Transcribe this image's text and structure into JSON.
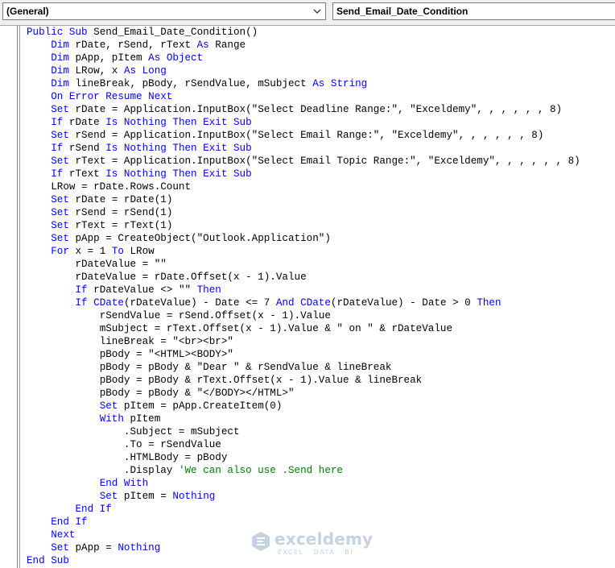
{
  "header": {
    "object_combo": "(General)",
    "procedure_combo": "Send_Email_Date_Condition"
  },
  "colors": {
    "keyword": "#0000ff",
    "comment": "#008000",
    "text": "#000000"
  },
  "code": [
    {
      "indent": 0,
      "parts": [
        [
          "kw",
          "Public Sub"
        ],
        [
          "t",
          " Send_Email_Date_Condition()"
        ]
      ]
    },
    {
      "indent": 1,
      "parts": [
        [
          "kw",
          "Dim"
        ],
        [
          "t",
          " rDate, rSend, rText "
        ],
        [
          "kw",
          "As"
        ],
        [
          "t",
          " Range"
        ]
      ]
    },
    {
      "indent": 1,
      "parts": [
        [
          "kw",
          "Dim"
        ],
        [
          "t",
          " pApp, pItem "
        ],
        [
          "kw",
          "As Object"
        ]
      ]
    },
    {
      "indent": 1,
      "parts": [
        [
          "kw",
          "Dim"
        ],
        [
          "t",
          " LRow, x "
        ],
        [
          "kw",
          "As Long"
        ]
      ]
    },
    {
      "indent": 1,
      "parts": [
        [
          "kw",
          "Dim"
        ],
        [
          "t",
          " lineBreak, pBody, rSendValue, mSubject "
        ],
        [
          "kw",
          "As String"
        ]
      ]
    },
    {
      "indent": 1,
      "parts": [
        [
          "kw",
          "On Error Resume Next"
        ]
      ]
    },
    {
      "indent": 1,
      "parts": [
        [
          "kw",
          "Set"
        ],
        [
          "t",
          " rDate = Application.InputBox(\"Select Deadline Range:\", \"Exceldemy\", , , , , , 8)"
        ]
      ]
    },
    {
      "indent": 1,
      "parts": [
        [
          "kw",
          "If"
        ],
        [
          "t",
          " rDate "
        ],
        [
          "kw",
          "Is Nothing Then Exit Sub"
        ]
      ]
    },
    {
      "indent": 1,
      "parts": [
        [
          "kw",
          "Set"
        ],
        [
          "t",
          " rSend = Application.InputBox(\"Select Email Range:\", \"Exceldemy\", , , , , , 8)"
        ]
      ]
    },
    {
      "indent": 1,
      "parts": [
        [
          "kw",
          "If"
        ],
        [
          "t",
          " rSend "
        ],
        [
          "kw",
          "Is Nothing Then Exit Sub"
        ]
      ]
    },
    {
      "indent": 1,
      "parts": [
        [
          "kw",
          "Set"
        ],
        [
          "t",
          " rText = Application.InputBox(\"Select Email Topic Range:\", \"Exceldemy\", , , , , , 8)"
        ]
      ]
    },
    {
      "indent": 1,
      "parts": [
        [
          "kw",
          "If"
        ],
        [
          "t",
          " rText "
        ],
        [
          "kw",
          "Is Nothing Then Exit Sub"
        ]
      ]
    },
    {
      "indent": 1,
      "parts": [
        [
          "t",
          "LRow = rDate.Rows.Count"
        ]
      ]
    },
    {
      "indent": 1,
      "parts": [
        [
          "kw",
          "Set"
        ],
        [
          "t",
          " rDate = rDate(1)"
        ]
      ]
    },
    {
      "indent": 1,
      "parts": [
        [
          "kw",
          "Set"
        ],
        [
          "t",
          " rSend = rSend(1)"
        ]
      ]
    },
    {
      "indent": 1,
      "parts": [
        [
          "kw",
          "Set"
        ],
        [
          "t",
          " rText = rText(1)"
        ]
      ]
    },
    {
      "indent": 1,
      "parts": [
        [
          "kw",
          "Set"
        ],
        [
          "t",
          " pApp = CreateObject(\"Outlook.Application\")"
        ]
      ]
    },
    {
      "indent": 1,
      "parts": [
        [
          "kw",
          "For"
        ],
        [
          "t",
          " x = 1 "
        ],
        [
          "kw",
          "To"
        ],
        [
          "t",
          " LRow"
        ]
      ]
    },
    {
      "indent": 2,
      "parts": [
        [
          "t",
          "rDateValue = \"\""
        ]
      ]
    },
    {
      "indent": 2,
      "parts": [
        [
          "t",
          "rDateValue = rDate.Offset(x - 1).Value"
        ]
      ]
    },
    {
      "indent": 2,
      "parts": [
        [
          "kw",
          "If"
        ],
        [
          "t",
          " rDateValue <> \"\" "
        ],
        [
          "kw",
          "Then"
        ]
      ]
    },
    {
      "indent": 2,
      "parts": [
        [
          "kw",
          "If"
        ],
        [
          "t",
          " "
        ],
        [
          "kw",
          "CDate"
        ],
        [
          "t",
          "(rDateValue) - Date <= 7 "
        ],
        [
          "kw",
          "And"
        ],
        [
          "t",
          " "
        ],
        [
          "kw",
          "CDate"
        ],
        [
          "t",
          "(rDateValue) - Date > 0 "
        ],
        [
          "kw",
          "Then"
        ]
      ]
    },
    {
      "indent": 3,
      "parts": [
        [
          "t",
          "rSendValue = rSend.Offset(x - 1).Value"
        ]
      ]
    },
    {
      "indent": 3,
      "parts": [
        [
          "t",
          "mSubject = rText.Offset(x - 1).Value & \" on \" & rDateValue"
        ]
      ]
    },
    {
      "indent": 3,
      "parts": [
        [
          "t",
          "lineBreak = \"<br><br>\""
        ]
      ]
    },
    {
      "indent": 3,
      "parts": [
        [
          "t",
          "pBody = \"<HTML><BODY>\""
        ]
      ]
    },
    {
      "indent": 3,
      "parts": [
        [
          "t",
          "pBody = pBody & \"Dear \" & rSendValue & lineBreak"
        ]
      ]
    },
    {
      "indent": 3,
      "parts": [
        [
          "t",
          "pBody = pBody & rText.Offset(x - 1).Value & lineBreak"
        ]
      ]
    },
    {
      "indent": 3,
      "parts": [
        [
          "t",
          "pBody = pBody & \"</BODY></HTML>\""
        ]
      ]
    },
    {
      "indent": 3,
      "parts": [
        [
          "kw",
          "Set"
        ],
        [
          "t",
          " pItem = pApp.CreateItem(0)"
        ]
      ]
    },
    {
      "indent": 3,
      "parts": [
        [
          "kw",
          "With"
        ],
        [
          "t",
          " pItem"
        ]
      ]
    },
    {
      "indent": 4,
      "parts": [
        [
          "t",
          ".Subject = mSubject"
        ]
      ]
    },
    {
      "indent": 4,
      "parts": [
        [
          "t",
          ".To = rSendValue"
        ]
      ]
    },
    {
      "indent": 4,
      "parts": [
        [
          "t",
          ".HTMLBody = pBody"
        ]
      ]
    },
    {
      "indent": 4,
      "parts": [
        [
          "t",
          ".Display "
        ],
        [
          "cm",
          "'We can also use .Send here"
        ]
      ]
    },
    {
      "indent": 3,
      "parts": [
        [
          "kw",
          "End With"
        ]
      ]
    },
    {
      "indent": 3,
      "parts": [
        [
          "kw",
          "Set"
        ],
        [
          "t",
          " pItem = "
        ],
        [
          "kw",
          "Nothing"
        ]
      ]
    },
    {
      "indent": 2,
      "parts": [
        [
          "kw",
          "End If"
        ]
      ]
    },
    {
      "indent": 1,
      "parts": [
        [
          "kw",
          "End If"
        ]
      ]
    },
    {
      "indent": 1,
      "parts": [
        [
          "kw",
          "Next"
        ]
      ]
    },
    {
      "indent": 1,
      "parts": [
        [
          "kw",
          "Set"
        ],
        [
          "t",
          " pApp = "
        ],
        [
          "kw",
          "Nothing"
        ]
      ]
    },
    {
      "indent": 0,
      "parts": [
        [
          "kw",
          "End Sub"
        ]
      ]
    }
  ],
  "watermark": {
    "name": "exceldemy",
    "tagline": "EXCEL · DATA · BI"
  }
}
